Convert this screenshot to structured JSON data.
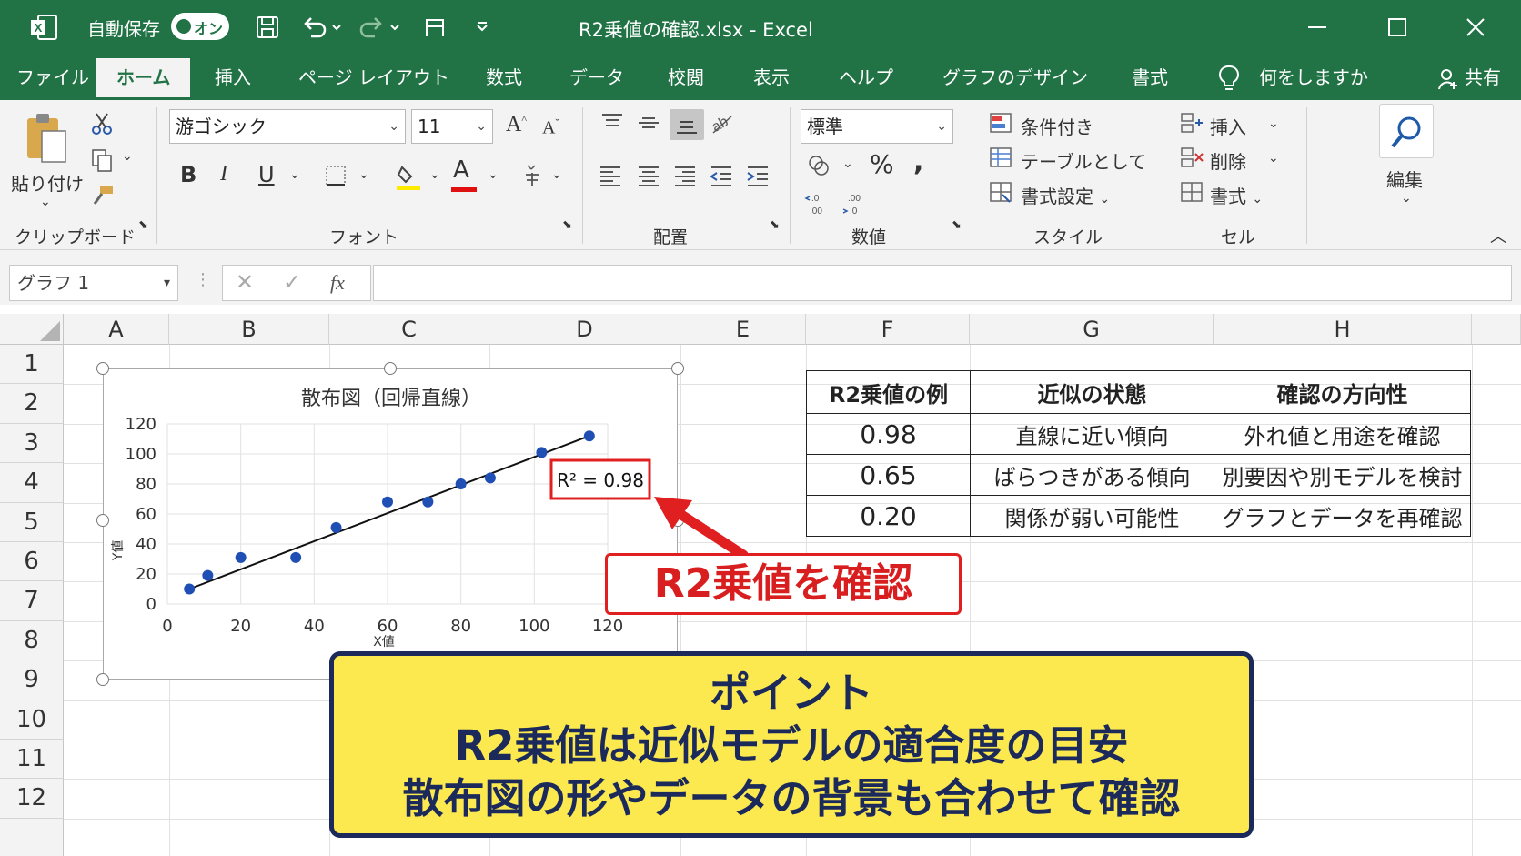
{
  "titlebar": {
    "autosave_label": "自動保存",
    "toggle_label": "オン",
    "doc_title": "R2乗値の確認.xlsx  -  Excel"
  },
  "ribbon_tabs": [
    "ファイル",
    "ホーム",
    "挿入",
    "ページ レイアウト",
    "数式",
    "データ",
    "校閲",
    "表示",
    "ヘルプ",
    "グラフのデザイン",
    "書式"
  ],
  "active_tab": "ホーム",
  "tell_me": "何をしますか",
  "share": "共有",
  "ribbon": {
    "clipboard": {
      "paste": "貼り付け",
      "label": "クリップボード"
    },
    "font": {
      "name": "游ゴシック",
      "size": "11",
      "label": "フォント",
      "bold": "B",
      "italic": "I",
      "underline": "U",
      "grow": "A",
      "shrink": "A",
      "font_color_glyph": "A"
    },
    "alignment": {
      "label": "配置"
    },
    "number": {
      "format": "標準",
      "percent": "%",
      "comma": ",",
      "label": "数値"
    },
    "styles": {
      "conditional": "条件付き",
      "table": "テーブルとして",
      "cell_styles": "書式設定",
      "label": "スタイル"
    },
    "cells": {
      "insert": "挿入",
      "delete": "削除",
      "format": "書式",
      "label": "セル"
    },
    "editing": {
      "label": "編集"
    }
  },
  "formula_bar": {
    "name_box": "グラフ 1",
    "fx": "fx",
    "formula": ""
  },
  "columns": [
    "A",
    "B",
    "C",
    "D",
    "E",
    "F",
    "G",
    "H"
  ],
  "rows": [
    "1",
    "2",
    "3",
    "4",
    "5",
    "6",
    "7",
    "8",
    "9",
    "10",
    "11",
    "12"
  ],
  "chart_data": {
    "type": "scatter",
    "title": "散布図（回帰直線）",
    "xlabel": "X値",
    "ylabel": "Y値",
    "xlim": [
      0,
      120
    ],
    "ylim": [
      0,
      120
    ],
    "xticks": [
      0,
      20,
      40,
      60,
      80,
      100,
      120
    ],
    "yticks": [
      0,
      20,
      40,
      60,
      80,
      100,
      120
    ],
    "grid": true,
    "point_color": "#1f4fb4",
    "series": [
      {
        "x": [
          6,
          11,
          20,
          35,
          46,
          60,
          71,
          80,
          88,
          102,
          115
        ],
        "y": [
          10,
          19,
          31,
          31,
          51,
          68,
          68,
          80,
          84,
          101,
          112
        ]
      }
    ],
    "trendline": {
      "x": [
        6,
        115
      ],
      "y": [
        10,
        112
      ]
    },
    "annotation": "R² = 0.98"
  },
  "table": {
    "headers": [
      "R2乗値の例",
      "近似の状態",
      "確認の方向性"
    ],
    "rows": [
      [
        "0.98",
        "直線に近い傾向",
        "外れ値と用途を確認"
      ],
      [
        "0.65",
        "ばらつきがある傾向",
        "別要因や別モデルを検討"
      ],
      [
        "0.20",
        "関係が弱い可能性",
        "グラフとデータを再確認"
      ]
    ]
  },
  "callout": "R2乗値を確認",
  "point": {
    "title": "ポイント",
    "line1": "R2乗値は近似モデルの適合度の目安",
    "line2": "散布図の形やデータの背景も合わせて確認"
  },
  "colors": {
    "excel_green": "#217346",
    "callout_red": "#e02020",
    "point_bg": "#fce94f",
    "point_text": "#1b2a5a"
  }
}
